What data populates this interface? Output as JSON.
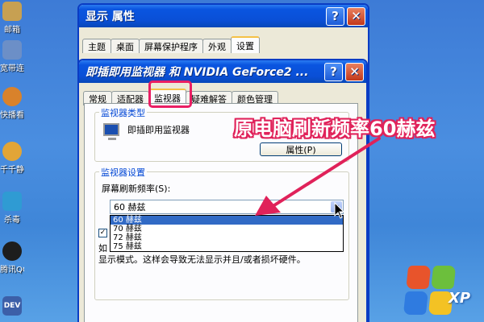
{
  "desktop": {
    "icons": [
      {
        "label": "邮箱",
        "icon": "mail-icon",
        "color": "#c7a052"
      },
      {
        "label": "宽带连接",
        "icon": "network-icon",
        "color": "#6c8fc7"
      },
      {
        "label": "快播看高清影视",
        "icon": "media-player-icon",
        "color": "#d9822b"
      },
      {
        "label": "千千静听",
        "icon": "music-player-icon",
        "color": "#e2a537"
      },
      {
        "label": "杀毒",
        "icon": "antivirus-icon",
        "color": "#2f9bd3"
      },
      {
        "label": "腾讯QQ",
        "icon": "qq-icon",
        "color": "#1d1d1d"
      },
      {
        "label": "DEV",
        "icon": "dev-icon",
        "color": "#3c5fa8"
      }
    ],
    "watermark": "XP"
  },
  "back_window": {
    "title": "显示 属性",
    "tabs": [
      "主题",
      "桌面",
      "屏幕保护程序",
      "外观",
      "设置"
    ],
    "active_tab": "设置"
  },
  "front_window": {
    "title": "即插即用监视器 和 NVIDIA GeForce2 ...",
    "tabs": [
      "常规",
      "适配器",
      "监视器",
      "疑难解答",
      "颜色管理"
    ],
    "active_tab": "监视器",
    "monitor_type": {
      "group_title": "监视器类型",
      "name": "即插即用监视器",
      "properties_button": "属性(P)"
    },
    "monitor_settings": {
      "group_title": "监视器设置",
      "refresh_label": "屏幕刷新频率(S):",
      "refresh_value": "60 赫兹",
      "options": [
        "60 赫兹",
        "70 赫兹",
        "72 赫兹",
        "75 赫兹"
      ],
      "selected_option": "60 赫兹",
      "hidden_text_1": "如",
      "hidden_text_2": "显示模式。这样会导致无法显示并且/或者损坏硬件。"
    }
  },
  "annotation": {
    "text": "原电脑刷新频率60赫兹",
    "color": "#e0225a"
  }
}
